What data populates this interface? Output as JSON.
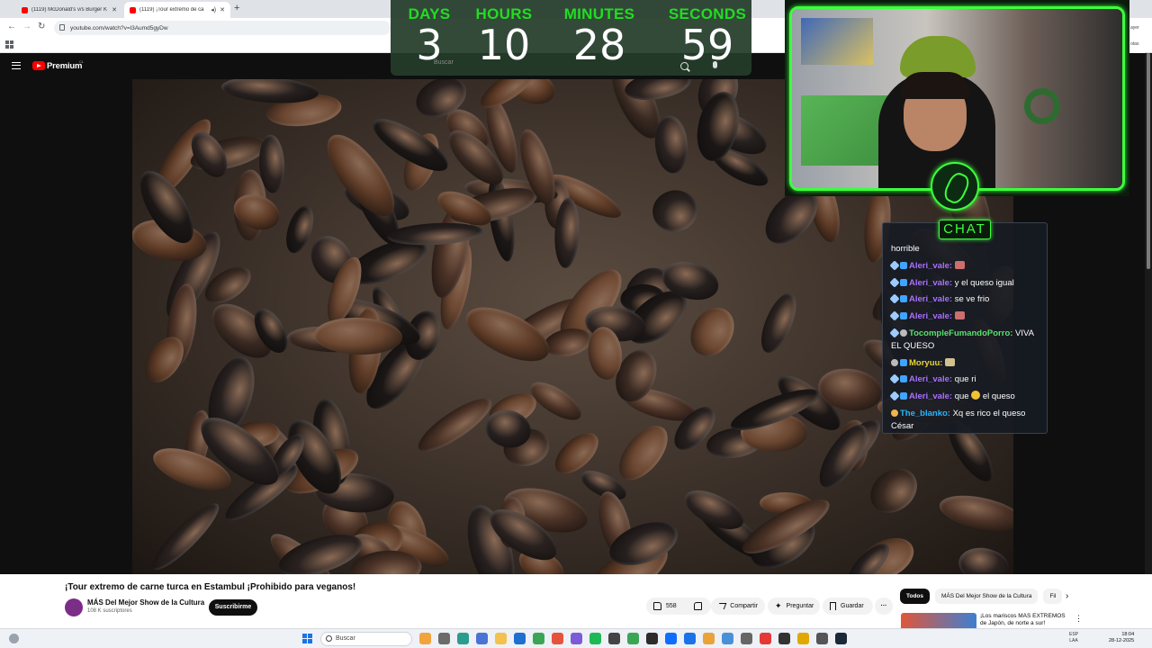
{
  "browser": {
    "tabs": [
      {
        "label": "(1119) McDonald's v/s Burger K"
      },
      {
        "label": "(1119) ¡Tour extremo de ca"
      }
    ],
    "url": "youtube.com/watch?v=l3Aumd5gyDw",
    "edge_labels": [
      "ayer",
      "otas"
    ]
  },
  "youtube": {
    "brand": "Premium",
    "region": "CL",
    "search_placeholder": "Buscar"
  },
  "timer": {
    "labels": [
      "DAYS",
      "HOURS",
      "MINUTES",
      "SECONDS"
    ],
    "values": [
      "3",
      "10",
      "28",
      "59"
    ]
  },
  "chat": {
    "title": "CHAT",
    "messages": [
      {
        "user": "",
        "text": "horrible",
        "user_color": ""
      },
      {
        "user": "Aleri_vale:",
        "text": "",
        "user_color": "#a970ff"
      },
      {
        "user": "Aleri_vale:",
        "text": "y el queso igual",
        "user_color": "#a970ff"
      },
      {
        "user": "Aleri_vale:",
        "text": "se ve frio",
        "user_color": "#a970ff"
      },
      {
        "user": "Aleri_vale:",
        "text": "",
        "user_color": "#a970ff"
      },
      {
        "user": "TocompleFumandoPorro:",
        "text": "VIVA EL QUESO",
        "user_color": "#59e16b"
      },
      {
        "user": "Moryuu:",
        "text": "",
        "user_color": "#e5d33a"
      },
      {
        "user": "Aleri_vale:",
        "text": "que ri",
        "user_color": "#a970ff"
      },
      {
        "user": "Aleri_vale:",
        "text": "que",
        "text2": "el queso",
        "user_color": "#a970ff"
      },
      {
        "user": "The_blanko:",
        "text": "Xq es rico el queso César",
        "user_color": "#25b7ff"
      }
    ]
  },
  "video": {
    "title": "¡Tour extremo de carne turca en Estambul ¡Prohibido para veganos!",
    "channel": "MÁS Del Mejor Show de la Cultura",
    "subscribers": "108 K suscriptores",
    "subscribe_label": "Suscribirme",
    "likes": "558",
    "share_label": "Compartir",
    "ask_label": "Preguntar",
    "save_label": "Guardar",
    "more_label": "···"
  },
  "recommendations": {
    "chips": [
      "Todos",
      "MÁS Del Mejor Show de la Cultura",
      "Fil"
    ],
    "first_title": "¡Los mariscos MÁS EXTREMOS de Japón, de norte a sur!"
  },
  "taskbar": {
    "search_label": "Buscar",
    "lang": "ESP",
    "lang_sub": "LAA",
    "time": "18:04",
    "date": "28-12-2025"
  },
  "colors": {
    "timer_label": "#22dd22",
    "cam_border": "#3cff3c",
    "yt_red": "#ff0000"
  }
}
